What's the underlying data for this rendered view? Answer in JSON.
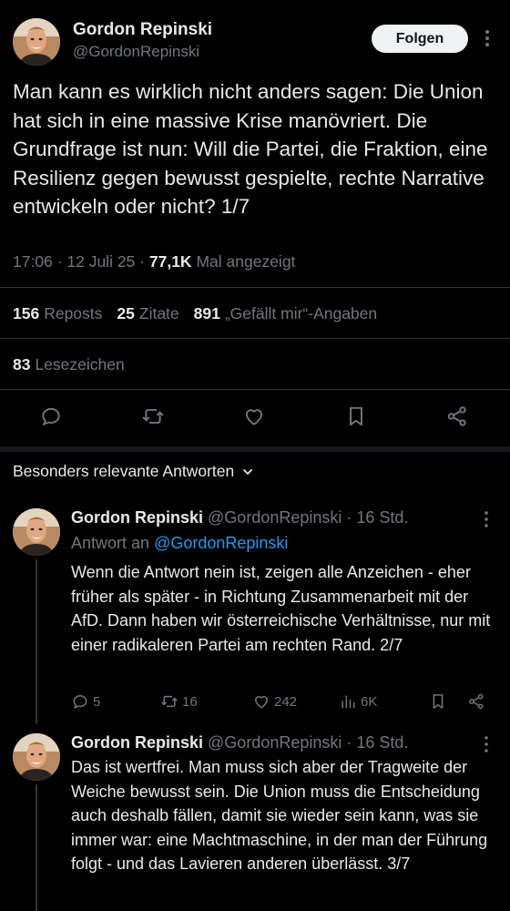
{
  "main_tweet": {
    "author_name": "Gordon Repinski",
    "author_handle": "@GordonRepinski",
    "follow_label": "Folgen",
    "text": "Man kann es wirklich nicht anders sagen: Die Union hat sich in eine massive Krise manövriert. Die Grundfrage ist nun: Will die Partei, die Fraktion, eine Resilienz gegen bewusst gespielte, rechte Narrative entwickeln oder nicht? 1/7",
    "time": "17:06",
    "sep1": "·",
    "date": "12 Juli 25",
    "sep2": "·",
    "views": "77,1K",
    "views_label": "Mal angezeigt",
    "stats": {
      "reposts_count": "156",
      "reposts_label": "Reposts",
      "quotes_count": "25",
      "quotes_label": "Zitate",
      "likes_count": "891",
      "likes_label": "„Gefällt mir“-Angaben",
      "bookmarks_count": "83",
      "bookmarks_label": "Lesezeichen"
    }
  },
  "section": {
    "relevant_label": "Besonders relevante Antworten"
  },
  "replies": [
    {
      "author_name": "Gordon Repinski",
      "author_handle": "@GordonRepinski",
      "sep": "·",
      "time": "16 Std.",
      "reply_to_label": "Antwort an",
      "reply_to_handle": "@GordonRepinski",
      "text": "Wenn die Antwort nein ist, zeigen alle Anzeichen - eher früher als später - in Richtung Zusammenarbeit mit der AfD. Dann haben wir österreichische Verhältnisse, nur mit einer radikaleren Partei am rechten Rand. 2/7",
      "replies": "5",
      "reposts": "16",
      "likes": "242",
      "views": "6K"
    },
    {
      "author_name": "Gordon Repinski",
      "author_handle": "@GordonRepinski",
      "sep": "·",
      "time": "16 Std.",
      "text": "Das ist wertfrei. Man muss sich aber der Tragweite der Weiche bewusst sein. Die Union muss die Entscheidung auch deshalb fällen, damit sie wieder sein kann, was sie immer war: eine Machtmaschine, in der man der Führung folgt - und das Lavieren anderen überlässt. 3/7"
    }
  ],
  "icons": {
    "reply": "reply-icon",
    "repost": "repost-icon",
    "like": "heart-icon",
    "bookmark": "bookmark-icon",
    "share": "share-icon",
    "views": "views-icon",
    "more": "more-icon",
    "chevron": "chevron-down-icon"
  },
  "colors": {
    "background": "#000000",
    "text": "#e7e9ea",
    "muted": "#71767b",
    "link": "#1d9bf0",
    "divider": "#2f3336",
    "follow_bg": "#eff3f4"
  }
}
